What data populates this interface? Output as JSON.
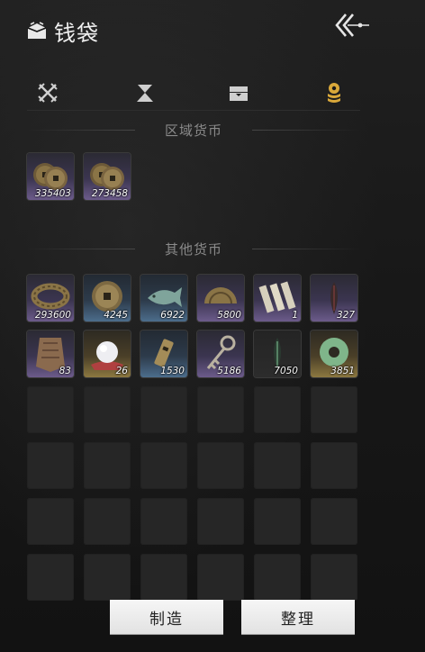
{
  "header": {
    "title": "钱袋",
    "title_icon": "money-pouch-icon",
    "back_icon": "back-arrow-icon"
  },
  "tabs": [
    {
      "name": "weapons",
      "icon": "crossed-swords-icon",
      "active": false
    },
    {
      "name": "consumables",
      "icon": "hourglass-icon",
      "active": false
    },
    {
      "name": "chest",
      "icon": "chest-icon",
      "active": false
    },
    {
      "name": "currency",
      "icon": "coin-stack-icon",
      "active": true
    }
  ],
  "active_color": "#d9a83a",
  "inactive_color": "#cfcfcf",
  "sections": {
    "regional": {
      "title": "区域货币",
      "items": [
        {
          "icon": "copper-coins-icon",
          "quality": "purple",
          "qty": "335403"
        },
        {
          "icon": "copper-coins-icon",
          "quality": "purple",
          "qty": "273458"
        }
      ]
    },
    "other": {
      "title": "其他货币",
      "items": [
        {
          "icon": "coin-string-icon",
          "quality": "purple",
          "qty": "293600"
        },
        {
          "icon": "square-hole-coin-icon",
          "quality": "blue",
          "qty": "4245"
        },
        {
          "icon": "jade-fish-icon",
          "quality": "blue",
          "qty": "6922"
        },
        {
          "icon": "half-coin-icon",
          "quality": "purple",
          "qty": "5800"
        },
        {
          "icon": "bamboo-tokens-icon",
          "quality": "purple",
          "qty": "1"
        },
        {
          "icon": "dark-feather-icon",
          "quality": "purple",
          "qty": "327"
        },
        {
          "icon": "bronze-tag-icon",
          "quality": "purple",
          "qty": "83"
        },
        {
          "icon": "pearl-icon",
          "quality": "gold",
          "qty": "26"
        },
        {
          "icon": "jade-pendant-icon",
          "quality": "blue",
          "qty": "1530"
        },
        {
          "icon": "key-charm-icon",
          "quality": "purple",
          "qty": "5186"
        },
        {
          "icon": "green-feather-icon",
          "quality": "dark",
          "qty": "7050"
        },
        {
          "icon": "jade-ring-icon",
          "quality": "gold",
          "qty": "3851"
        }
      ]
    }
  },
  "buttons": {
    "craft": "制造",
    "sort": "整理"
  }
}
